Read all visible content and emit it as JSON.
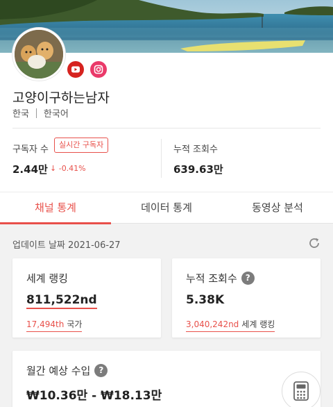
{
  "colors": {
    "accent": "#e8504a",
    "youtube": "#d6231f",
    "instagram": "#ea3a6a"
  },
  "channel": {
    "name": "고양이구하는남자",
    "country": "한국",
    "language": "한국어",
    "socials": [
      "youtube-icon",
      "instagram-icon"
    ]
  },
  "stats": {
    "subscribers_label": "구독자 수",
    "live_badge": "실시간 구독자",
    "subscribers_value": "2.44만",
    "subscribers_change": "-0.41%",
    "views_label": "누적 조회수",
    "views_value": "639.63만"
  },
  "tabs": [
    {
      "label": "채널 통계",
      "active": true
    },
    {
      "label": "데이터 통계",
      "active": false
    },
    {
      "label": "동영상 분석",
      "active": false
    }
  ],
  "update": {
    "text": "업데이트 날짜 2021-06-27"
  },
  "cards": {
    "world_rank": {
      "title": "세계 랭킹",
      "value": "811,522nd",
      "sub_value": "17,494th",
      "sub_suffix": "국가"
    },
    "total_views": {
      "title": "누적 조회수",
      "help": "?",
      "value": "5.38K",
      "sub_value": "3,040,242nd",
      "sub_suffix": "세계 랭킹"
    },
    "monthly_income": {
      "title": "월간 예상 수입",
      "help": "?",
      "value": "₩10.36만 - ₩18.13만"
    }
  }
}
